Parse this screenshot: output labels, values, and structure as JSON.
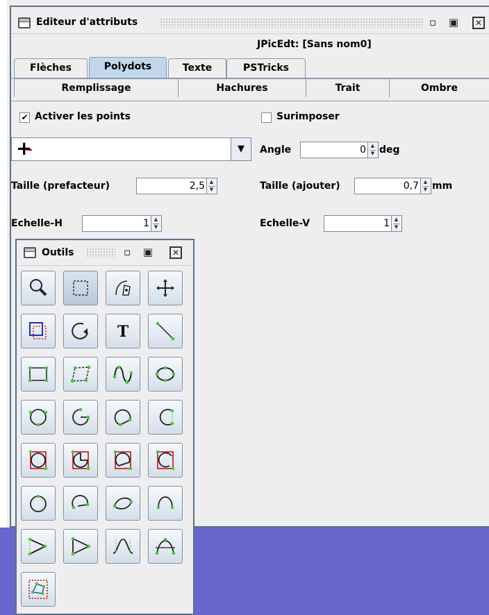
{
  "window": {
    "title": "Editeur d'attributs",
    "subtitle": "JPicEdt: [Sans nom0]"
  },
  "tabs_row1": [
    {
      "label": "Flèches",
      "selected": false
    },
    {
      "label": "Polydots",
      "selected": true
    },
    {
      "label": "Texte",
      "selected": false
    },
    {
      "label": "PSTricks",
      "selected": false
    }
  ],
  "tabs_row2": [
    {
      "label": "Remplissage"
    },
    {
      "label": "Hachures"
    },
    {
      "label": "Trait"
    },
    {
      "label": "Ombre"
    }
  ],
  "form": {
    "activate_points": {
      "label": "Activer les points",
      "checked": true,
      "mark": "✔"
    },
    "superimpose": {
      "label": "Surimposer",
      "checked": false
    },
    "dot_style": {
      "glyph": "+",
      "color": "#cc0000"
    },
    "angle": {
      "label": "Angle",
      "value": "0",
      "unit": "deg"
    },
    "size_factor": {
      "label": "Taille (prefacteur)",
      "value": "2,5"
    },
    "size_add": {
      "label": "Taille (ajouter)",
      "value": "0,7",
      "unit": "mm"
    },
    "scale_h": {
      "label": "Echelle-H",
      "value": "1"
    },
    "scale_v": {
      "label": "Echelle-V",
      "value": "1"
    }
  },
  "tools_window": {
    "title": "Outils",
    "buttons": [
      "zoom-tool-icon",
      "select-rect-tool-icon",
      "pen-tool-icon",
      "move-tool-icon",
      "crop-tool-icon",
      "rotate-tool-icon",
      "text-tool-icon",
      "line-tool-icon",
      "rectangle-tool-icon",
      "parallelogram-tool-icon",
      "curve-tool-icon",
      "ellipse-tool-icon",
      "circle-3pt-tool-icon",
      "arc-pie-tool-icon",
      "arc-chord-tool-icon",
      "arc-open-tool-icon",
      "circle-framed-tool-icon",
      "pie-framed-tool-icon",
      "chord-framed-tool-icon",
      "arc-framed-tool-icon",
      "circle-loop-tool-icon",
      "arc-partial-tool-icon",
      "lens-tool-icon",
      "hook-tool-icon",
      "angle-polyline-tool-icon",
      "triangle-tool-icon",
      "bell-curve-tool-icon",
      "spline-tool-icon",
      "bounding-box-tool-icon"
    ]
  },
  "colors": {
    "desktop": "#6666cc",
    "selected_tab": "#c2d6ec",
    "frame_border": "#5c7088",
    "handle": "#44cc33",
    "frame_red": "#cc0000"
  }
}
